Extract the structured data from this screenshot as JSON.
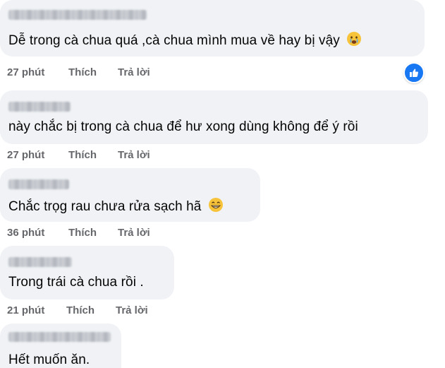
{
  "comments": [
    {
      "text": "Dễ trong cà chua quá ,cà chua mình mua về hay bị vậy",
      "time": "27 phút",
      "like_label": "Thích",
      "reply_label": "Trả lời",
      "emoji": "crying-face-icon",
      "has_reaction": true
    },
    {
      "text": "này chắc bị trong cà chua để hư xong dùng không để ý rồi",
      "time": "27 phút",
      "like_label": "Thích",
      "reply_label": "Trả lời"
    },
    {
      "text": "Chắc trọg rau chưa rửa sạch hã",
      "time": "36 phút",
      "like_label": "Thích",
      "reply_label": "Trả lời",
      "emoji": "grinning-face-icon"
    },
    {
      "text": "Trong trái cà chua rồi .",
      "time": "21 phút",
      "like_label": "Thích",
      "reply_label": "Trả lời"
    },
    {
      "text": "Hết muốn ăn.",
      "time": "",
      "like_label": "",
      "reply_label": ""
    }
  ],
  "colors": {
    "bubble": "#f0f2f5",
    "meta_text": "#65676b",
    "like_badge": "#1877f2"
  }
}
